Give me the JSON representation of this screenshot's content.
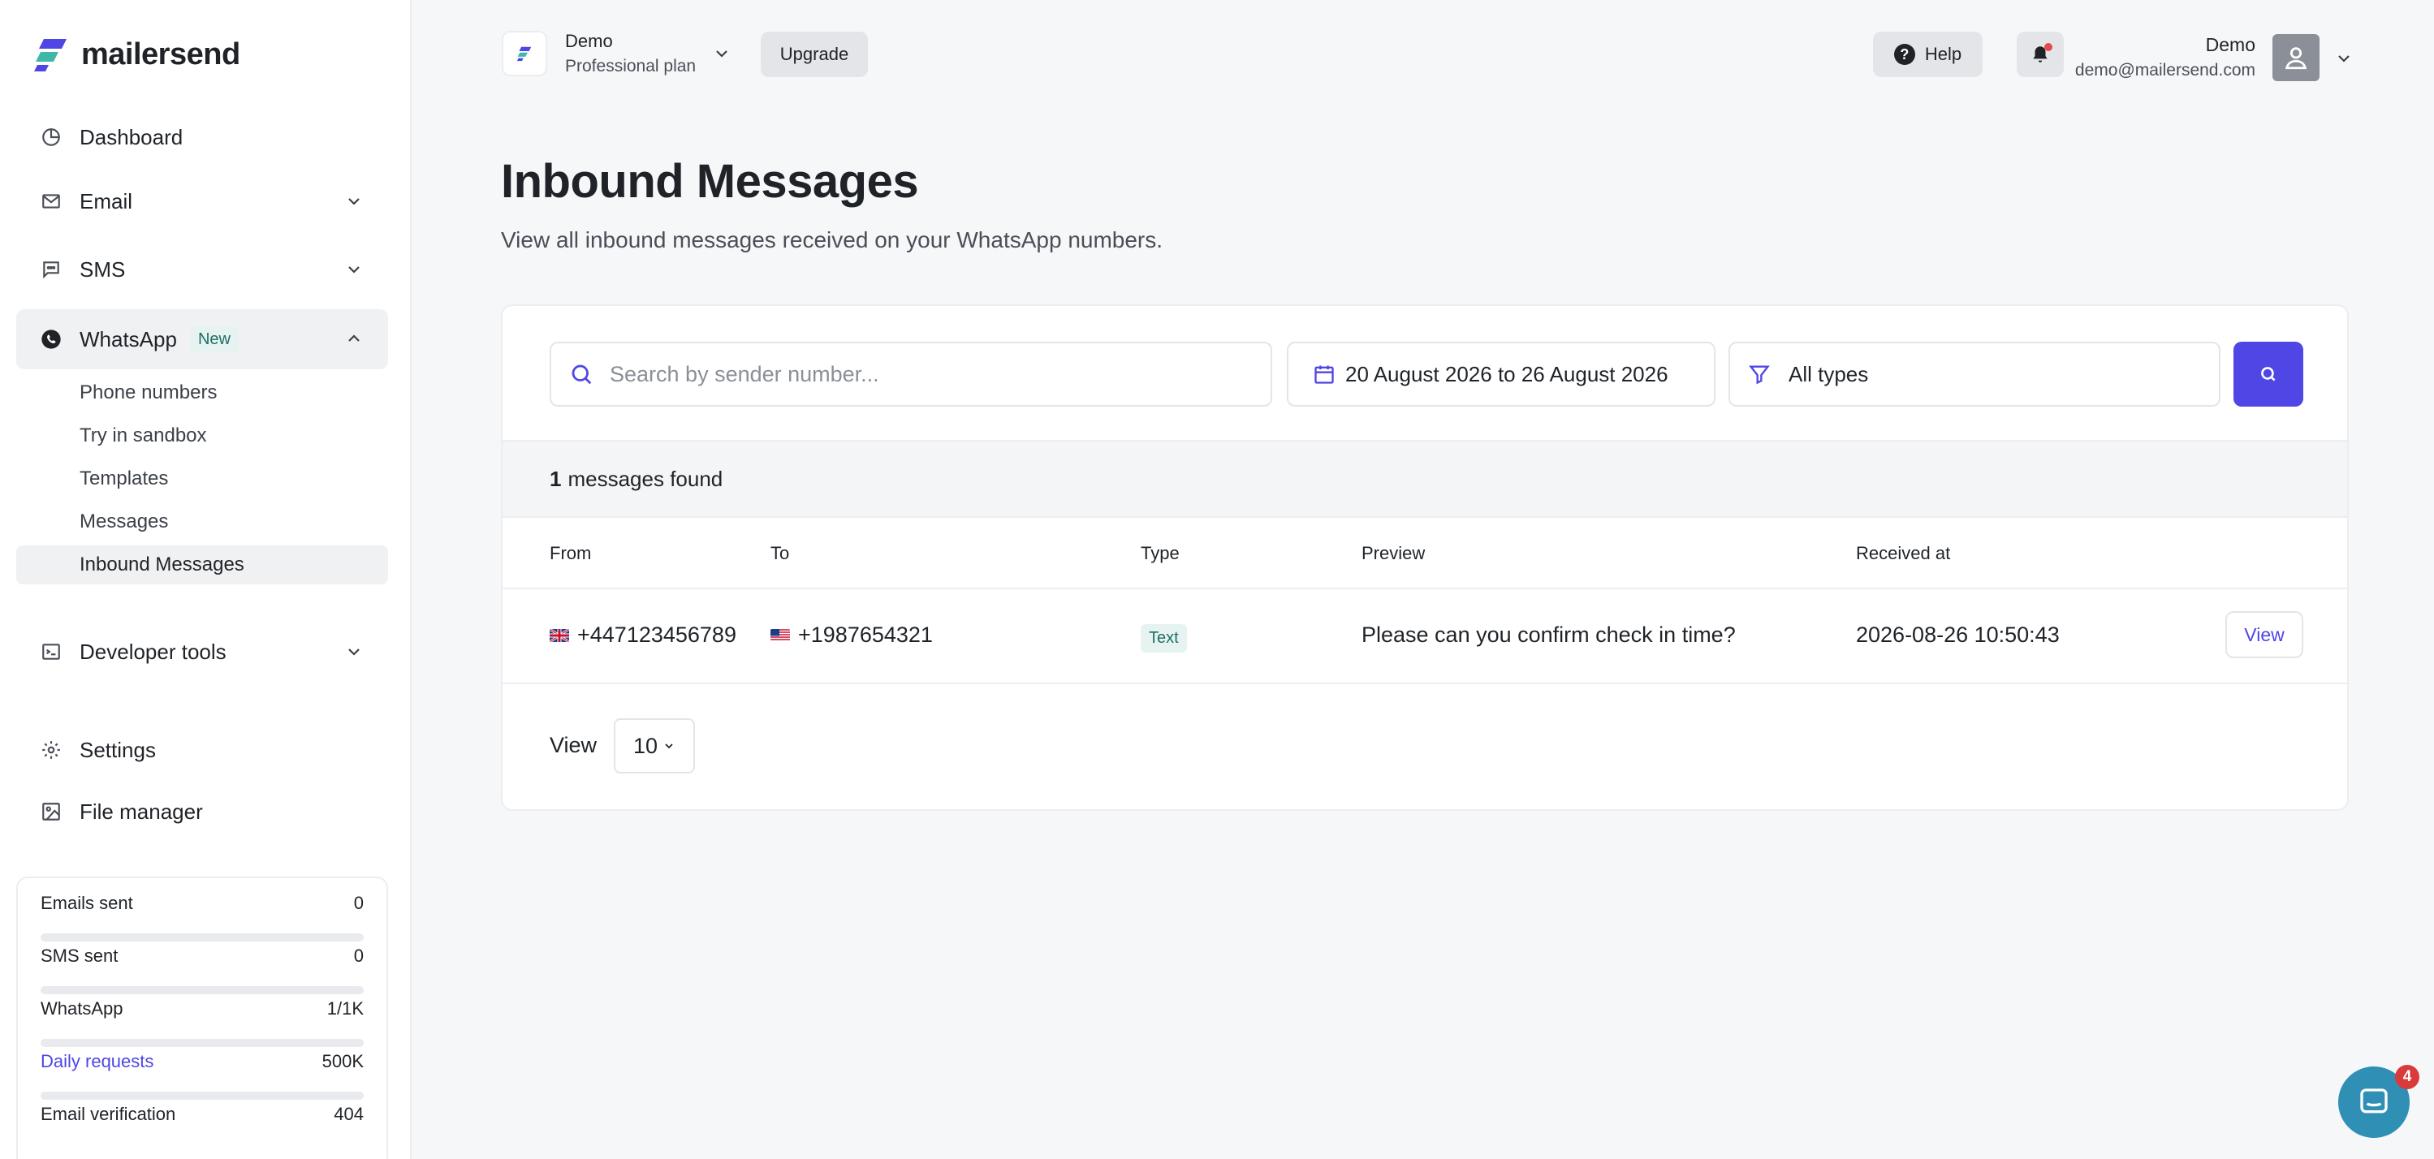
{
  "brand": {
    "name": "mailersend",
    "accent": "#4f46e5"
  },
  "sidebar": {
    "items": [
      {
        "label": "Dashboard",
        "icon": "dashboard-icon"
      },
      {
        "label": "Email",
        "icon": "mail-icon"
      },
      {
        "label": "SMS",
        "icon": "sms-icon"
      },
      {
        "label": "WhatsApp",
        "icon": "whatsapp-icon",
        "badge": "New"
      },
      {
        "label": "Developer tools",
        "icon": "code-icon"
      },
      {
        "label": "Settings",
        "icon": "gear-icon"
      },
      {
        "label": "File manager",
        "icon": "image-icon"
      }
    ],
    "whatsapp_sub": [
      "Phone numbers",
      "Try in sandbox",
      "Templates",
      "Messages",
      "Inbound Messages"
    ]
  },
  "usage": [
    {
      "label": "Emails sent",
      "value": "0",
      "fill": 0
    },
    {
      "label": "SMS sent",
      "value": "0",
      "fill": 0
    },
    {
      "label": "WhatsApp",
      "value": "1/1K",
      "fill": 0
    },
    {
      "label": "Daily requests",
      "value": "500K",
      "fill": 0
    },
    {
      "label": "Email verification",
      "value": "404",
      "fill": 0
    }
  ],
  "topbar": {
    "workspace_name": "Demo",
    "workspace_plan": "Professional plan",
    "upgrade_label": "Upgrade",
    "help_label": "Help",
    "user_name": "Demo",
    "user_email": "demo@mailersend.com"
  },
  "page": {
    "title": "Inbound Messages",
    "subtitle": "View all inbound messages received on your WhatsApp numbers."
  },
  "filters": {
    "search_placeholder": "Search by sender number...",
    "date_range": "20 August 2026 to 26 August 2026",
    "type": "All types"
  },
  "results": {
    "count": "1",
    "text": "messages found"
  },
  "table": {
    "headers": [
      "From",
      "To",
      "Type",
      "Preview",
      "Received at"
    ],
    "rows": [
      {
        "from": "+447123456789",
        "to": "+1987654321",
        "type": "Text",
        "preview": "Please can you confirm check in time?",
        "received": "2026-08-26 10:50:43",
        "action": "View"
      }
    ]
  },
  "pager": {
    "label": "View",
    "per_page": "10"
  },
  "chat": {
    "unread": "4"
  }
}
